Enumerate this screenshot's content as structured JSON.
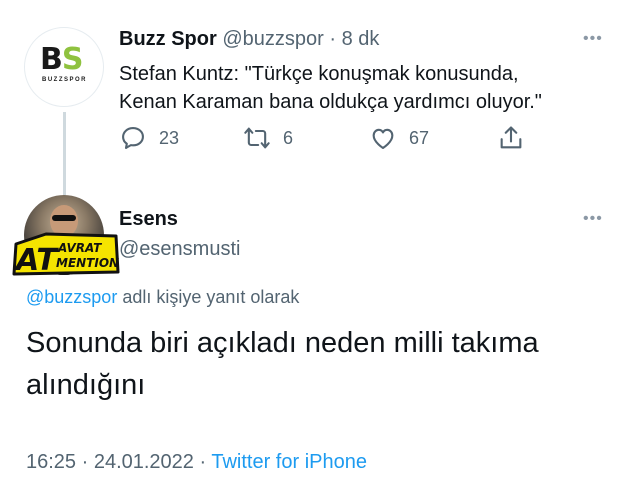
{
  "tweet1": {
    "avatar_logo": {
      "letters_b": "B",
      "letters_s": "S",
      "subtitle": "BUZZSPOR"
    },
    "name": "Buzz Spor",
    "handle": "@buzzspor",
    "separator": "·",
    "time": "8 dk",
    "more_icon": "ellipsis-icon",
    "text_line1": "Stefan Kuntz: \"Türkçe konuşmak konusunda,",
    "text_line2": "Kenan Karaman bana oldukça yardımcı oluyor.\"",
    "actions": {
      "reply_count": "23",
      "retweet_count": "6",
      "like_count": "67"
    }
  },
  "tweet2": {
    "sticker": {
      "at": "AT",
      "line1": "AVRAT",
      "line2": "MENTION"
    },
    "name": "Esens",
    "handle": "@esensmusti",
    "more_icon": "ellipsis-icon",
    "reply_mention": "@buzzspor",
    "reply_suffix": " adlı kişiye yanıt olarak",
    "text_line1": "Sonunda biri açıkladı neden milli takıma",
    "text_line2": "alındığını",
    "meta_time": "16:25 · 24.01.2022 · ",
    "meta_source": "Twitter for iPhone"
  },
  "colors": {
    "link": "#1d9bf0",
    "secondary_text": "#536471",
    "brand_green": "#8fc23f",
    "sticker_yellow": "#f5e400"
  }
}
